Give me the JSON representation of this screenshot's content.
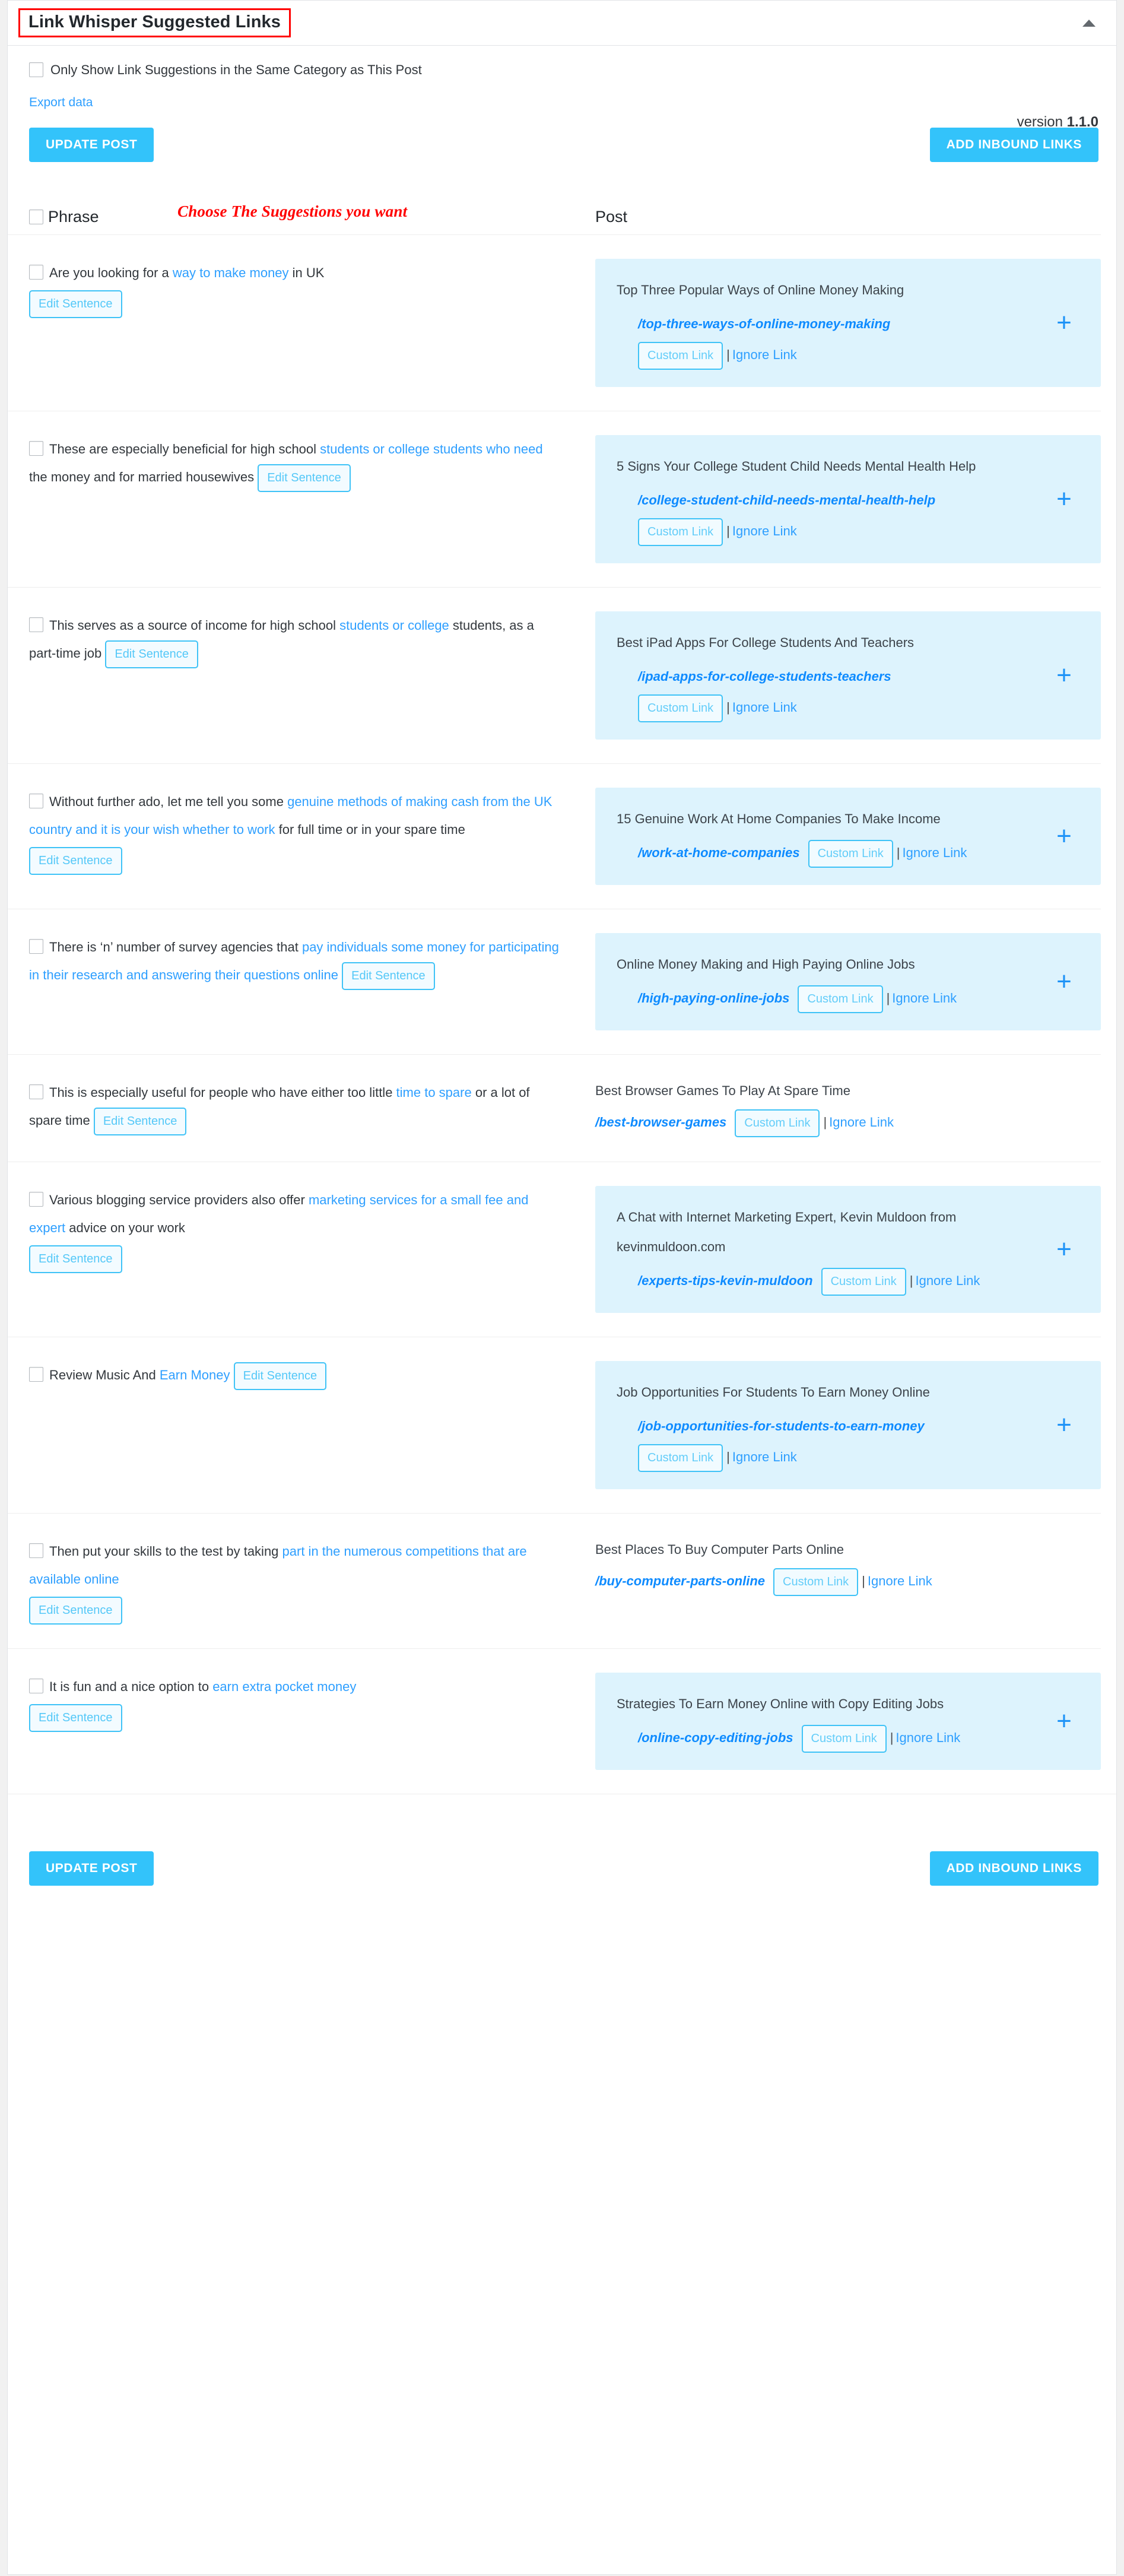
{
  "panel": {
    "title": "Link Whisper Suggested Links",
    "collapse_icon": "chevron-up-icon"
  },
  "controls": {
    "same_category_label": "Only Show Link Suggestions in the Same Category as This Post",
    "version_prefix": "version ",
    "version_number": "1.1.0",
    "export_label": "Export data",
    "update_post_label": "UPDATE POST",
    "add_inbound_links_label": "ADD INBOUND LINKS"
  },
  "table": {
    "header_phrase": "Phrase",
    "header_post": "Post",
    "annotation": "Choose The Suggestions you want",
    "edit_sentence_label": "Edit Sentence",
    "custom_link_label": "Custom Link",
    "ignore_link_label": "Ignore Link",
    "separator": "|",
    "add_icon": "plus-icon"
  },
  "colors": {
    "accent": "#33c3fa",
    "link": "#2e9fff",
    "slug": "#0e8bff",
    "card_bg": "#ddf3fd",
    "annotation": "#ff0000"
  },
  "rows": [
    {
      "phrase_parts": [
        {
          "text": "Are you looking for a ",
          "kw": false
        },
        {
          "text": "way to make money",
          "kw": true
        },
        {
          "text": " in UK",
          "kw": false
        }
      ],
      "edit_inline": false,
      "post_title": "Top Three Popular Ways of Online Money Making",
      "slug": "/top-three-ways-of-online-money-making",
      "actions_wrap": true,
      "highlight": true,
      "has_plus": true
    },
    {
      "phrase_parts": [
        {
          "text": "These are especially beneficial for high school ",
          "kw": false
        },
        {
          "text": "students or college students who need",
          "kw": true
        },
        {
          "text": " the money and for married housewives ",
          "kw": false
        }
      ],
      "edit_inline": true,
      "post_title": "5 Signs Your College Student Child Needs Mental Health Help",
      "slug": "/college-student-child-needs-mental-health-help",
      "actions_wrap": true,
      "highlight": true,
      "has_plus": true
    },
    {
      "phrase_parts": [
        {
          "text": "This serves as a source of income for high school ",
          "kw": false
        },
        {
          "text": "students or college",
          "kw": true
        },
        {
          "text": " students, as a part-time job ",
          "kw": false
        }
      ],
      "edit_inline": true,
      "post_title": "Best iPad Apps For College Students And Teachers",
      "slug": "/ipad-apps-for-college-students-teachers",
      "actions_wrap": true,
      "highlight": true,
      "has_plus": true
    },
    {
      "phrase_parts": [
        {
          "text": "Without further ado, let me tell you some ",
          "kw": false
        },
        {
          "text": "genuine methods of making cash from the UK country and it is your wish whether to work",
          "kw": true
        },
        {
          "text": " for full time or in your spare time",
          "kw": false
        }
      ],
      "edit_inline": false,
      "post_title": "15 Genuine Work At Home Companies To Make Income",
      "slug": "/work-at-home-companies",
      "actions_wrap": false,
      "highlight": true,
      "has_plus": true
    },
    {
      "phrase_parts": [
        {
          "text": "There is ‘n’ number of survey agencies that ",
          "kw": false
        },
        {
          "text": "pay individuals some money for participating in their research and answering their questions online",
          "kw": true
        },
        {
          "text": " ",
          "kw": false
        }
      ],
      "edit_inline": true,
      "post_title": "Online Money Making and High Paying Online Jobs",
      "slug": "/high-paying-online-jobs",
      "actions_wrap": false,
      "highlight": true,
      "has_plus": true
    },
    {
      "phrase_parts": [
        {
          "text": "This is especially useful for people who have either too little ",
          "kw": false
        },
        {
          "text": "time to spare",
          "kw": true
        },
        {
          "text": " or a lot of spare time ",
          "kw": false
        }
      ],
      "edit_inline": true,
      "post_title": "Best Browser Games To Play At Spare Time",
      "slug": "/best-browser-games",
      "actions_wrap": false,
      "highlight": false,
      "has_plus": false
    },
    {
      "phrase_parts": [
        {
          "text": "Various blogging service providers also offer ",
          "kw": false
        },
        {
          "text": "marketing services for a small fee and expert",
          "kw": true
        },
        {
          "text": " advice on your work",
          "kw": false
        }
      ],
      "edit_inline": false,
      "post_title": "A Chat with Internet Marketing Expert, Kevin Muldoon from kevinmuldoon.com",
      "slug": "/experts-tips-kevin-muldoon",
      "actions_wrap": false,
      "highlight": true,
      "has_plus": true
    },
    {
      "phrase_parts": [
        {
          "text": "Review Music And ",
          "kw": false
        },
        {
          "text": "Earn Money",
          "kw": true
        },
        {
          "text": " ",
          "kw": false
        }
      ],
      "edit_inline": true,
      "post_title": "Job Opportunities For Students To Earn Money Online",
      "slug": "/job-opportunities-for-students-to-earn-money",
      "actions_wrap": true,
      "highlight": true,
      "has_plus": true
    },
    {
      "phrase_parts": [
        {
          "text": "Then put your skills to the test by taking ",
          "kw": false
        },
        {
          "text": "part in the numerous competitions that are available online",
          "kw": true
        },
        {
          "text": "",
          "kw": false
        }
      ],
      "edit_inline": false,
      "post_title": "Best Places To Buy Computer Parts Online",
      "slug": "/buy-computer-parts-online",
      "actions_wrap": false,
      "highlight": false,
      "has_plus": false
    },
    {
      "phrase_parts": [
        {
          "text": "It is fun and a nice option to ",
          "kw": false
        },
        {
          "text": "earn extra pocket money",
          "kw": true
        },
        {
          "text": "",
          "kw": false
        }
      ],
      "edit_inline": false,
      "post_title": "Strategies To Earn Money Online with Copy Editing Jobs",
      "slug": "/online-copy-editing-jobs",
      "actions_wrap": false,
      "highlight": true,
      "has_plus": true
    }
  ],
  "footer": {
    "update_post_label": "UPDATE POST",
    "add_inbound_links_label": "ADD INBOUND LINKS"
  }
}
